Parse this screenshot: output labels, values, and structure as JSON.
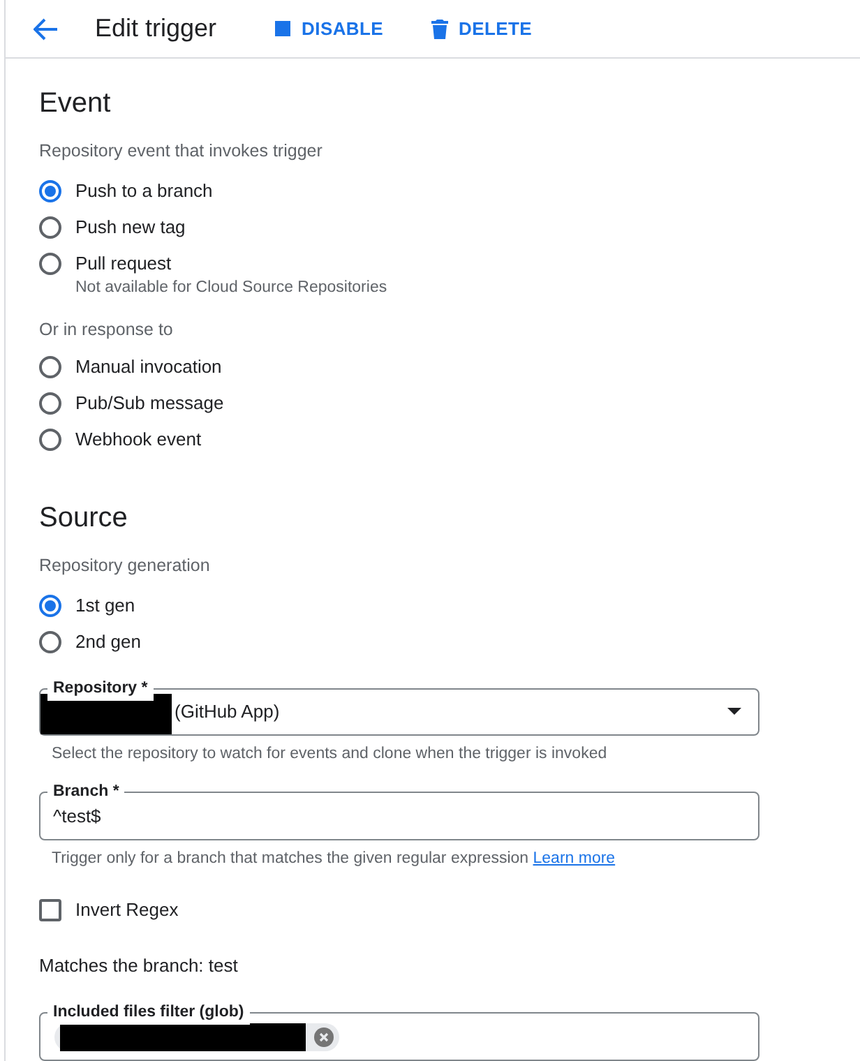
{
  "header": {
    "title": "Edit trigger",
    "actions": [
      {
        "label": "DISABLE",
        "kind": "disable"
      },
      {
        "label": "DELETE",
        "kind": "delete"
      }
    ]
  },
  "event": {
    "heading": "Event",
    "subtitle": "Repository event that invokes trigger",
    "options": [
      {
        "label": "Push to a branch",
        "selected": true
      },
      {
        "label": "Push new tag",
        "selected": false
      },
      {
        "label": "Pull request",
        "selected": false,
        "hint": "Not available for Cloud Source Repositories"
      }
    ],
    "response_label": "Or in response to",
    "response_options": [
      {
        "label": "Manual invocation",
        "selected": false
      },
      {
        "label": "Pub/Sub message",
        "selected": false
      },
      {
        "label": "Webhook event",
        "selected": false
      }
    ]
  },
  "source": {
    "heading": "Source",
    "subtitle": "Repository generation",
    "options": [
      {
        "label": "1st gen",
        "selected": true
      },
      {
        "label": "2nd gen",
        "selected": false
      }
    ],
    "repository": {
      "label": "Repository *",
      "value": "(GitHub App)",
      "hint": "Select the repository to watch for events and clone when the trigger is invoked"
    },
    "branch": {
      "label": "Branch *",
      "value": "^test$",
      "hint": "Trigger only for a branch that matches the given regular expression",
      "link": "Learn more"
    },
    "invert_regex": {
      "label": "Invert Regex",
      "checked": false
    },
    "matches": "Matches the branch: test",
    "included_files": {
      "label": "Included files filter (glob)"
    }
  }
}
